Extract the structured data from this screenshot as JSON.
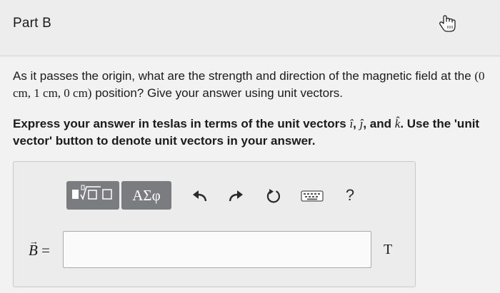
{
  "header": {
    "part_title": "Part B"
  },
  "question": {
    "intro": "As it passes the origin, what are the strength and direction of the magnetic field at the ",
    "position": "(0 cm, 1 cm, 0 cm)",
    "outro": " position? Give your answer using unit vectors."
  },
  "instruction": {
    "text1": "Express your answer in teslas in terms of the unit vectors ",
    "unit_i": "î",
    "sep1": ", ",
    "unit_j": "ĵ",
    "sep2": ", and ",
    "unit_k": "k̂",
    "text2": ". Use the 'unit vector' button to denote unit vectors in your answer."
  },
  "toolbar": {
    "symbols_label": "ΑΣφ",
    "help_label": "?",
    "icons": [
      "templates-icon",
      "undo-icon",
      "redo-icon",
      "reset-icon",
      "keyboard-icon",
      "help-icon"
    ]
  },
  "answer": {
    "label": "B",
    "equals": "=",
    "value": "",
    "unit": "T"
  },
  "colors": {
    "toolbar_button": "#7a7c80",
    "page_background": "#f2f2f3",
    "header_background": "#ededee"
  }
}
